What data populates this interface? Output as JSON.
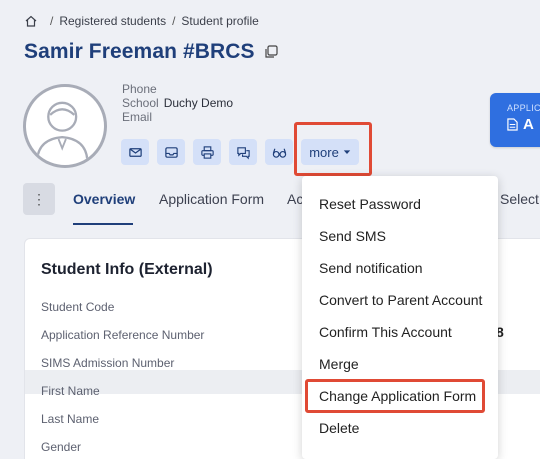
{
  "breadcrumb": {
    "home_icon": "home-icon",
    "item1": "Registered students",
    "separator": "/",
    "item2": "Student profile"
  },
  "student": {
    "name": "Samir Freeman #BRCS"
  },
  "meta": {
    "phone_label": "Phone",
    "school_label": "School",
    "school_value": "Duchy Demo",
    "email_label": "Email"
  },
  "actions": {
    "icons": [
      "mail-icon",
      "inbox-icon",
      "printer-icon",
      "chat-icon",
      "glasses-icon"
    ],
    "more_label": "more"
  },
  "apply": {
    "sub": "APPLIC",
    "main": "A"
  },
  "tabs": {
    "items": [
      "Overview",
      "Application Form",
      "Ac",
      "Select"
    ]
  },
  "card": {
    "title": "Student Info (External)",
    "fields": [
      "Student Code",
      "Application Reference Number",
      "SIMS Admission Number",
      "First Name",
      "Last Name",
      "Gender"
    ],
    "value_fragment": "8"
  },
  "menu": {
    "items": [
      "Reset Password",
      "Send SMS",
      "Send notification",
      "Convert to Parent Account",
      "Confirm This Account",
      "Merge",
      "Change Application Form",
      "Delete"
    ]
  },
  "colors": {
    "accent": "#1f3f7a",
    "button_bg": "#d4e0f8",
    "highlight": "#e04a35",
    "primary": "#2f6fe0"
  }
}
